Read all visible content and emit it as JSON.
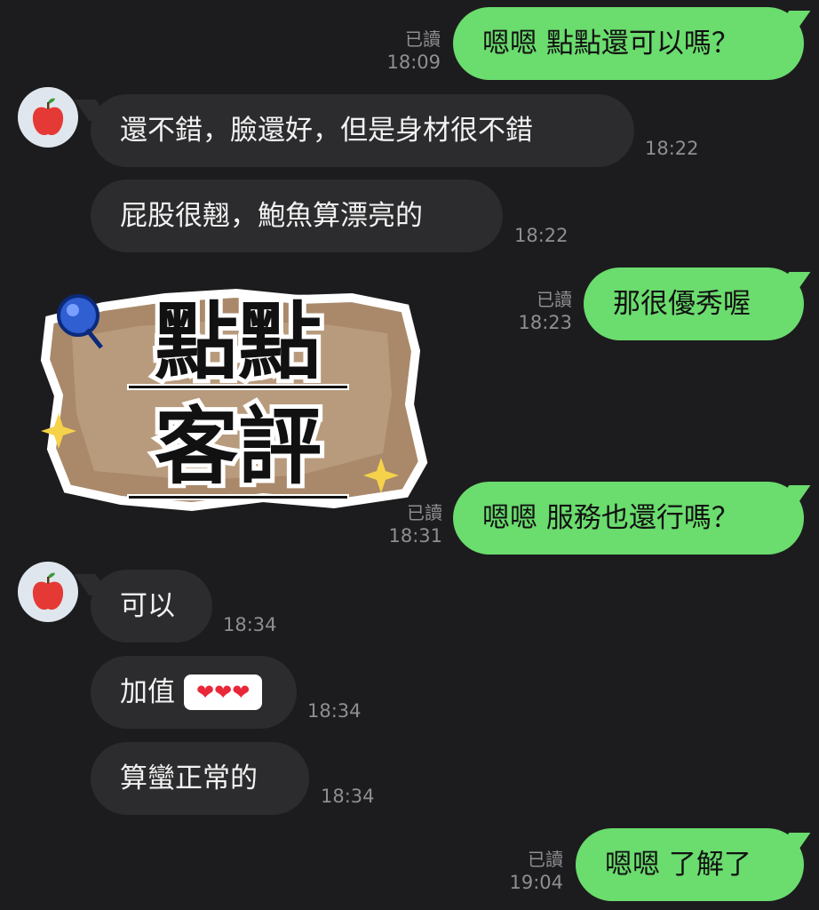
{
  "colors": {
    "background": "#1c1c1e",
    "outgoing_bubble": "#6bdc6e",
    "incoming_bubble": "#2c2c2e",
    "meta_text": "#8e8e93"
  },
  "contact": {
    "avatar_icon": "apple-icon"
  },
  "messages": [
    {
      "side": "out",
      "text": "嗯嗯 點點還可以嗎？",
      "read": "已讀",
      "time": "18:09"
    },
    {
      "side": "in",
      "text": "還不錯，臉還好，但是身材很不錯",
      "time": "18:22"
    },
    {
      "side": "in",
      "text": "屁股很翹，鮑魚算漂亮的",
      "time": "18:22"
    },
    {
      "side": "out",
      "text": "那很優秀喔",
      "read": "已讀",
      "time": "18:23"
    },
    {
      "side": "out",
      "text": "嗯嗯 服務也還行嗎？",
      "read": "已讀",
      "time": "18:31"
    },
    {
      "side": "in",
      "text": "可以",
      "time": "18:34"
    },
    {
      "side": "in",
      "text": "加值",
      "hearts": "❤❤❤",
      "time": "18:34"
    },
    {
      "side": "in",
      "text": "算蠻正常的",
      "time": "18:34"
    },
    {
      "side": "out",
      "text": "嗯嗯 了解了",
      "read": "已讀",
      "time": "19:04"
    }
  ],
  "sticker": {
    "line1": "點點",
    "line2": "客評"
  }
}
